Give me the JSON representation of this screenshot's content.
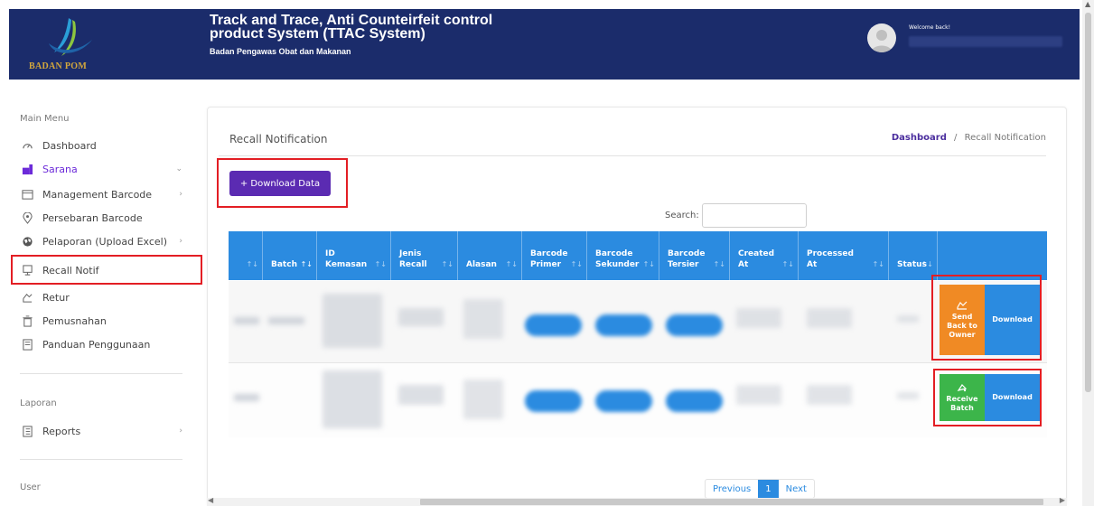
{
  "header": {
    "logo_text": "BADAN POM",
    "title": "Track and Trace, Anti Counteirfeit control product System (TTAC System)",
    "subtitle": "Badan Pengawas Obat dan Makanan",
    "welcome": "Welcome back!",
    "avatar_icon": "user-avatar-icon"
  },
  "sidebar": {
    "main_menu_title": "Main Menu",
    "items": [
      {
        "label": "Dashboard",
        "icon": "gauge-icon"
      },
      {
        "label": "Sarana",
        "icon": "building-icon",
        "chevron": "⌄"
      },
      {
        "label": "Management Barcode",
        "icon": "folder-icon",
        "chevron": "›"
      },
      {
        "label": "Persebaran Barcode",
        "icon": "map-pin-icon"
      },
      {
        "label": "Pelaporan (Upload Excel)",
        "icon": "globe-icon",
        "chevron": "›"
      },
      {
        "label": "Recall Notif",
        "icon": "monitor-icon"
      },
      {
        "label": "Retur",
        "icon": "return-icon"
      },
      {
        "label": "Pemusnahan",
        "icon": "trash-icon"
      },
      {
        "label": "Panduan Penggunaan",
        "icon": "book-icon"
      }
    ],
    "laporan_title": "Laporan",
    "reports": {
      "label": "Reports",
      "icon": "report-icon",
      "chevron": "›"
    },
    "user_title": "User",
    "accent_color": "#6c2bd9"
  },
  "main": {
    "card_title": "Recall Notification",
    "breadcrumb_link": "Dashboard",
    "breadcrumb_sep": "/",
    "breadcrumb_current": "Recall Notification",
    "download_button": "+ Download Data",
    "search_label": "Search:",
    "search_value": "",
    "table": {
      "columns": [
        "",
        "Batch",
        "ID Kemasan",
        "Jenis Recall",
        "Alasan",
        "Barcode Primer",
        "Barcode Sekunder",
        "Barcode Tersier",
        "Created At",
        "Processed At",
        "Status",
        ""
      ],
      "rows": [
        {
          "actions": [
            "Send Back to Owner",
            "Download"
          ]
        },
        {
          "actions": [
            "Receive Batch",
            "Download"
          ]
        }
      ]
    },
    "pagination": {
      "previous": "Previous",
      "current": "1",
      "next": "Next"
    }
  },
  "colors": {
    "header_bg": "#1b2c6b",
    "table_header": "#2b8be0",
    "primary_button": "#5b2bb2",
    "send_back": "#f08a24",
    "receive": "#3cb54a",
    "highlight_border": "#e31e24"
  }
}
